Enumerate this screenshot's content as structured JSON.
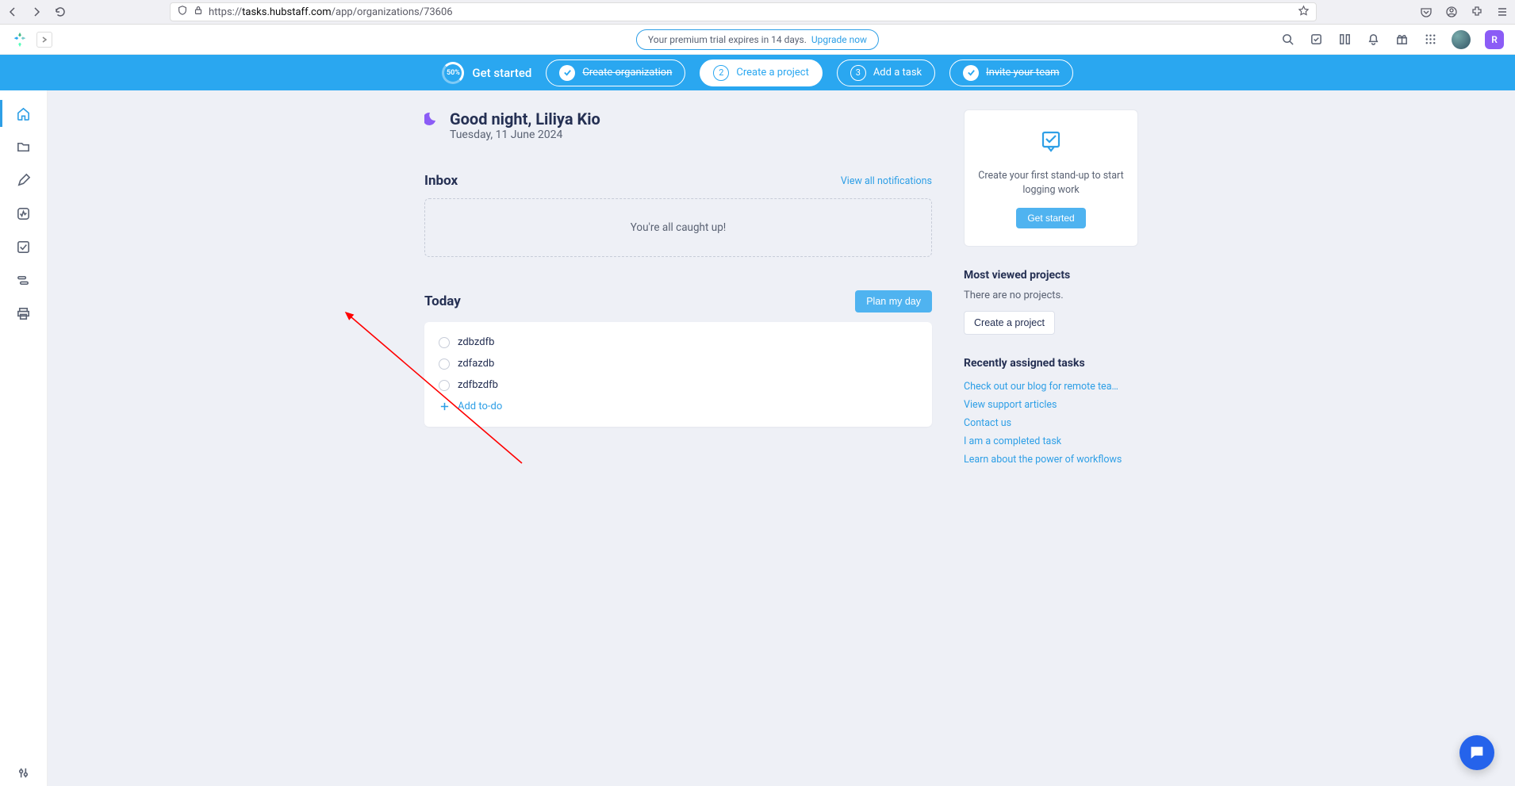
{
  "browser": {
    "url_prefix": "https://",
    "url_domain": "tasks.hubstaff.com",
    "url_path": "/app/organizations/73606"
  },
  "top_bar": {
    "trial_text": "Your premium trial expires in 14 days.",
    "upgrade_label": "Upgrade now",
    "badge_letter": "R"
  },
  "onboard": {
    "progress_label": "50%",
    "get_started": "Get started",
    "steps": {
      "create_org": "Create organization",
      "create_project": "Create a project",
      "add_task": "Add a task",
      "invite_team": "Invite your team"
    },
    "step2_num": "2",
    "step3_num": "3"
  },
  "greeting": {
    "title": "Good night, Liliya Kio",
    "date": "Tuesday, 11 June 2024"
  },
  "inbox": {
    "heading": "Inbox",
    "view_all": "View all notifications",
    "empty_text": "You're all caught up!"
  },
  "today": {
    "heading": "Today",
    "plan_btn": "Plan my day",
    "todos": [
      "zdbzdfb",
      "zdfazdb",
      "zdfbzdfb"
    ],
    "add_label": "Add to-do"
  },
  "standup": {
    "text": "Create your first stand-up to start logging work",
    "btn": "Get started"
  },
  "projects": {
    "heading": "Most viewed projects",
    "empty": "There are no projects.",
    "create_btn": "Create a project"
  },
  "recent_tasks": {
    "heading": "Recently assigned tasks",
    "links": [
      "Check out our blog for remote tea…",
      "View support articles",
      "Contact us",
      "I am a completed task",
      "Learn about the power of workflows"
    ]
  }
}
